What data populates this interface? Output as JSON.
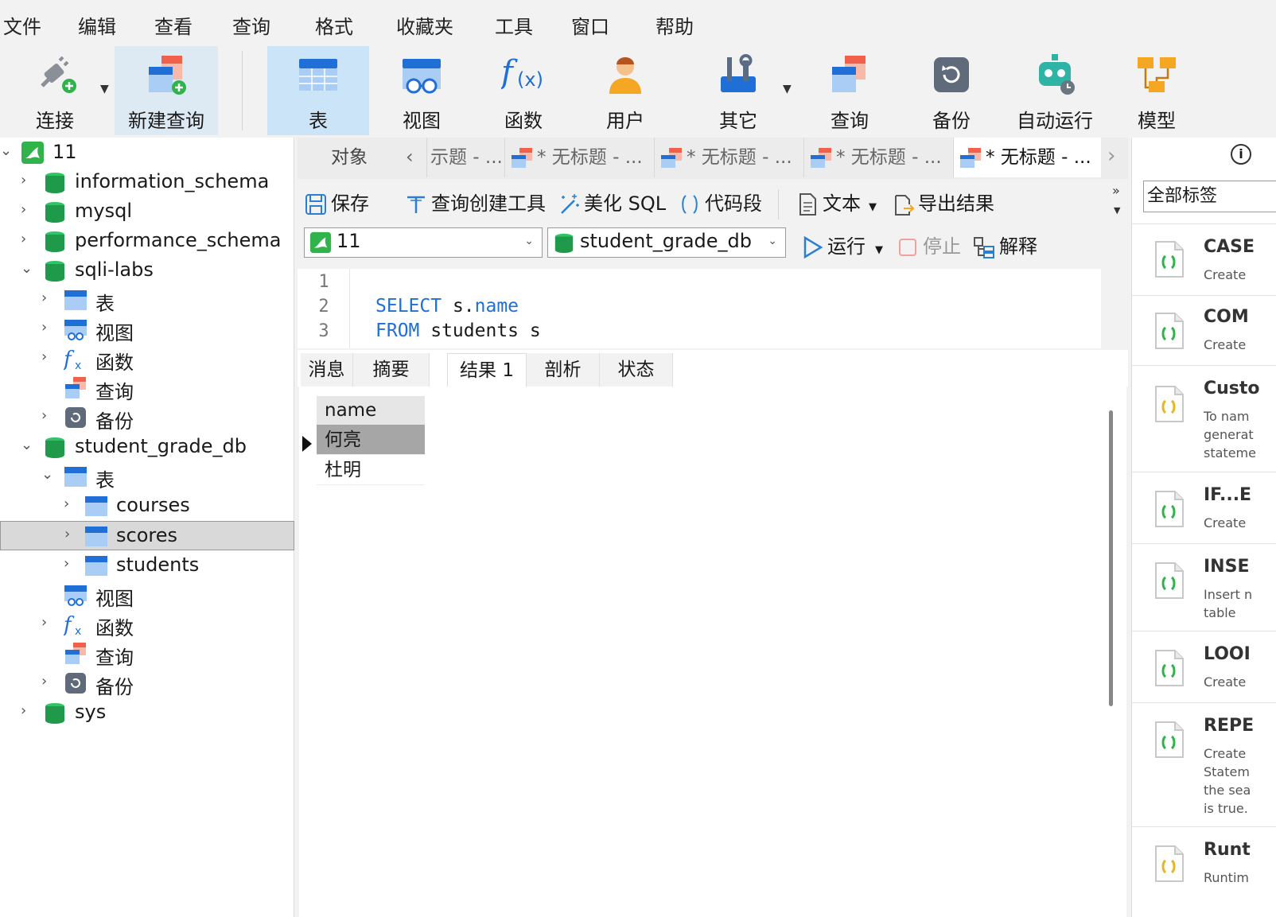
{
  "menu": [
    "文件",
    "编辑",
    "查看",
    "查询",
    "格式",
    "收藏夹",
    "工具",
    "窗口",
    "帮助"
  ],
  "toolbar": {
    "connect": "连接",
    "new_query": "新建查询",
    "table": "表",
    "view": "视图",
    "function": "函数",
    "user": "用户",
    "other": "其它",
    "query": "查询",
    "backup": "备份",
    "automation": "自动运行",
    "model": "模型"
  },
  "tree": {
    "connection": "11",
    "databases": {
      "information_schema": "information_schema",
      "mysql": "mysql",
      "performance_schema": "performance_schema",
      "sqli_labs": "sqli-labs",
      "student_grade_db": "student_grade_db",
      "sys": "sys"
    },
    "nodes": {
      "tables": "表",
      "views": "视图",
      "functions": "函数",
      "queries": "查询",
      "backups": "备份"
    },
    "tables": [
      "courses",
      "scores",
      "students"
    ]
  },
  "tabs": {
    "objects": "对象",
    "query_tabs": [
      "示题 - ...",
      "* 无标题 - ...",
      "* 无标题 - ...",
      "* 无标题 - ...",
      "* 无标题 - ..."
    ]
  },
  "query_toolbar": {
    "save": "保存",
    "builder": "查询创建工具",
    "beautify": "美化 SQL",
    "snippet": "代码段",
    "text": "文本",
    "export": "导出结果",
    "run": "运行",
    "stop": "停止",
    "explain": "解释"
  },
  "connection_select": "11",
  "database_select": "student_grade_db",
  "editor": {
    "line_numbers": [
      "1",
      "2",
      "3"
    ],
    "line2_kw": "SELECT",
    "line2_rest": " s.",
    "line2_col": "name",
    "line3_kw": "FROM",
    "line3_rest": " students s"
  },
  "result_tabs": [
    "消息",
    "摘要",
    "结果 1",
    "剖析",
    "状态"
  ],
  "results": {
    "column": "name",
    "rows": [
      "何亮",
      "杜明"
    ]
  },
  "right_panel": {
    "info": "i",
    "tag_filter": "全部标签",
    "snippets": [
      {
        "title": "CASE",
        "desc": "Create"
      },
      {
        "title": "COM",
        "desc": "Create"
      },
      {
        "title": "Custo",
        "desc": "To nam\ngenerat\nstateme"
      },
      {
        "title": "IF...E",
        "desc": "Create"
      },
      {
        "title": "INSE",
        "desc": "Insert n\ntable"
      },
      {
        "title": "LOOI",
        "desc": "Create"
      },
      {
        "title": "REPE",
        "desc": "Create\nStatem\nthe sea\nis true."
      },
      {
        "title": "Runt",
        "desc": "Runtim"
      }
    ]
  },
  "colors": {
    "accent": "#1f6fd6",
    "db_green": "#1e9a4a",
    "selected_toolbar": "#cce4f7"
  }
}
